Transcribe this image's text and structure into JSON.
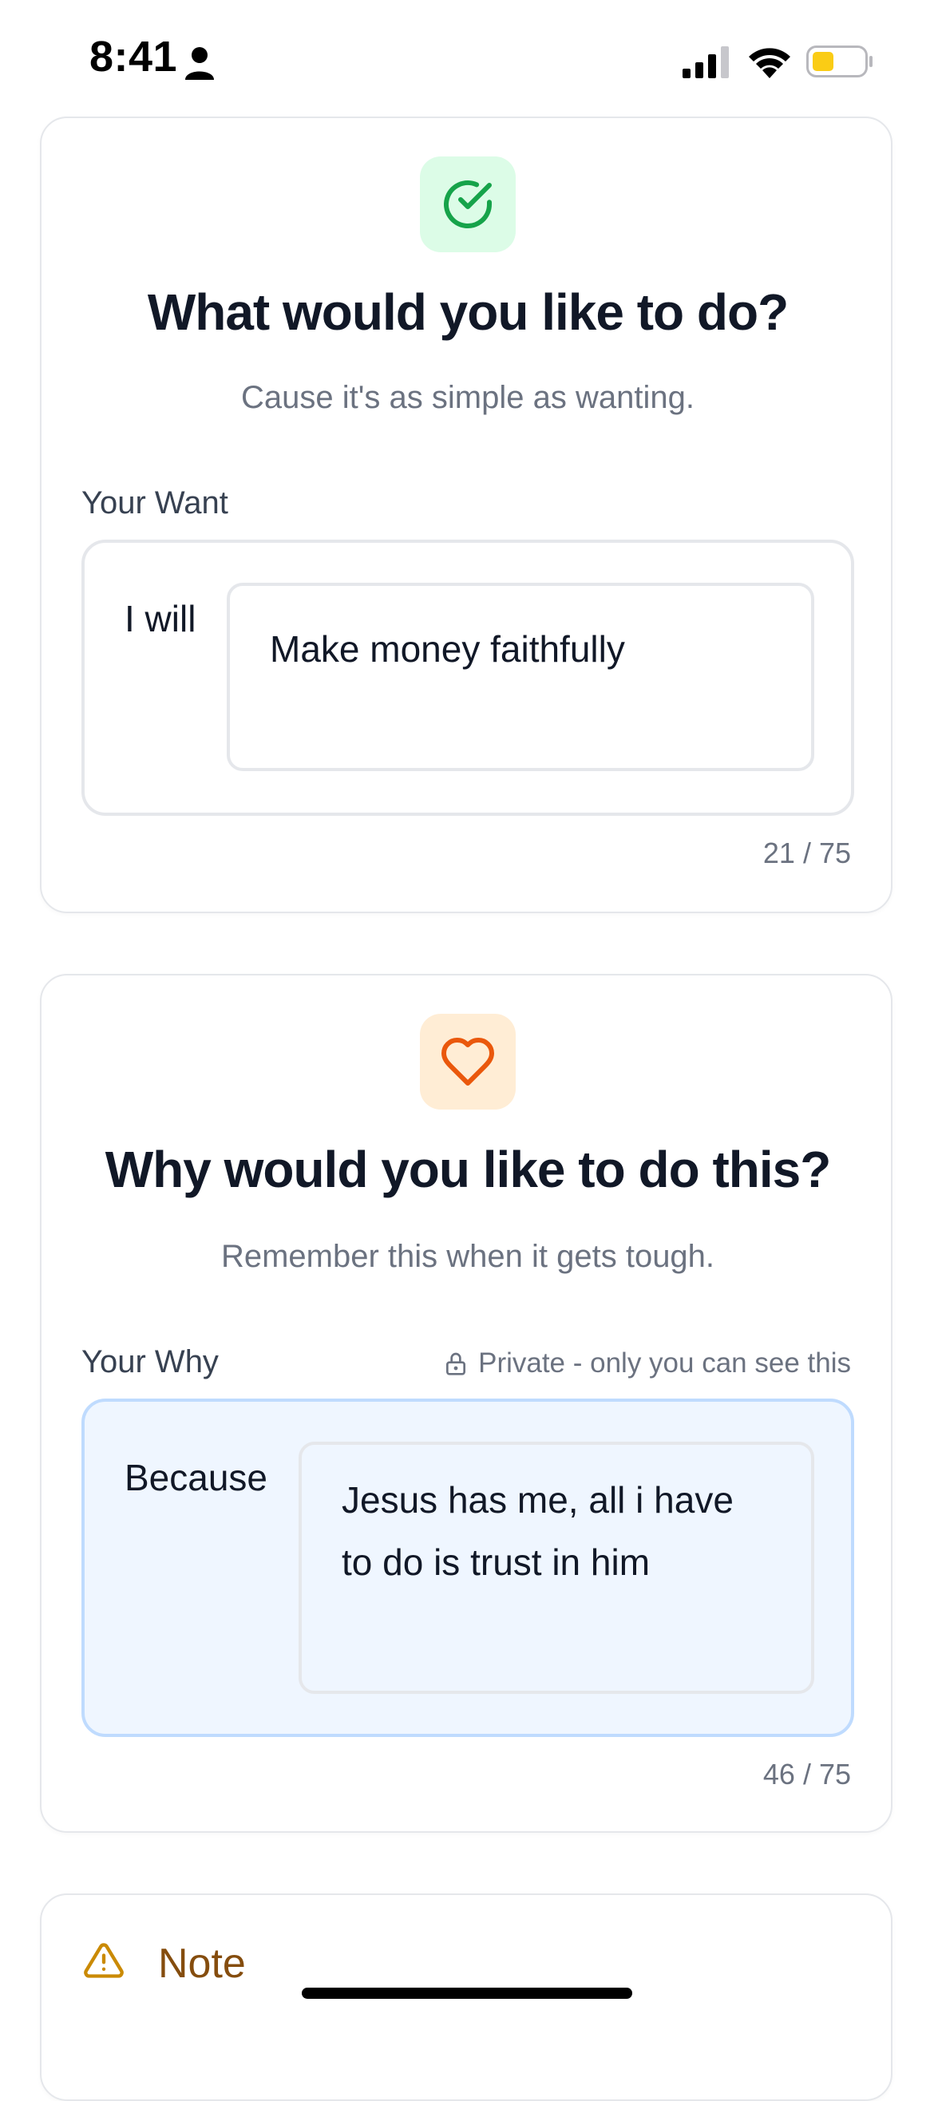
{
  "status_bar": {
    "time": "8:41",
    "battery_color": "#facc15"
  },
  "want_card": {
    "icon": "check-circle-icon",
    "title": "What would you like to do?",
    "subtitle": "Cause it's as simple as wanting.",
    "field_label": "Your Want",
    "prefix": "I will",
    "value": "Make money faithfully",
    "counter": "21 / 75"
  },
  "why_card": {
    "icon": "heart-icon",
    "title": "Why would you like to do this?",
    "subtitle": "Remember this when it gets tough.",
    "field_label": "Your Why",
    "private_label": "Private - only you can see this",
    "prefix": "Because",
    "value": "Jesus has me, all i have to do is trust in him",
    "counter": "46 / 75"
  },
  "note_card": {
    "icon": "warning-icon",
    "title": "Note"
  },
  "colors": {
    "green_accent": "#16a34a",
    "orange_accent": "#ea580c",
    "why_field_bg": "#eff6ff",
    "note_accent": "#ca8a04"
  }
}
